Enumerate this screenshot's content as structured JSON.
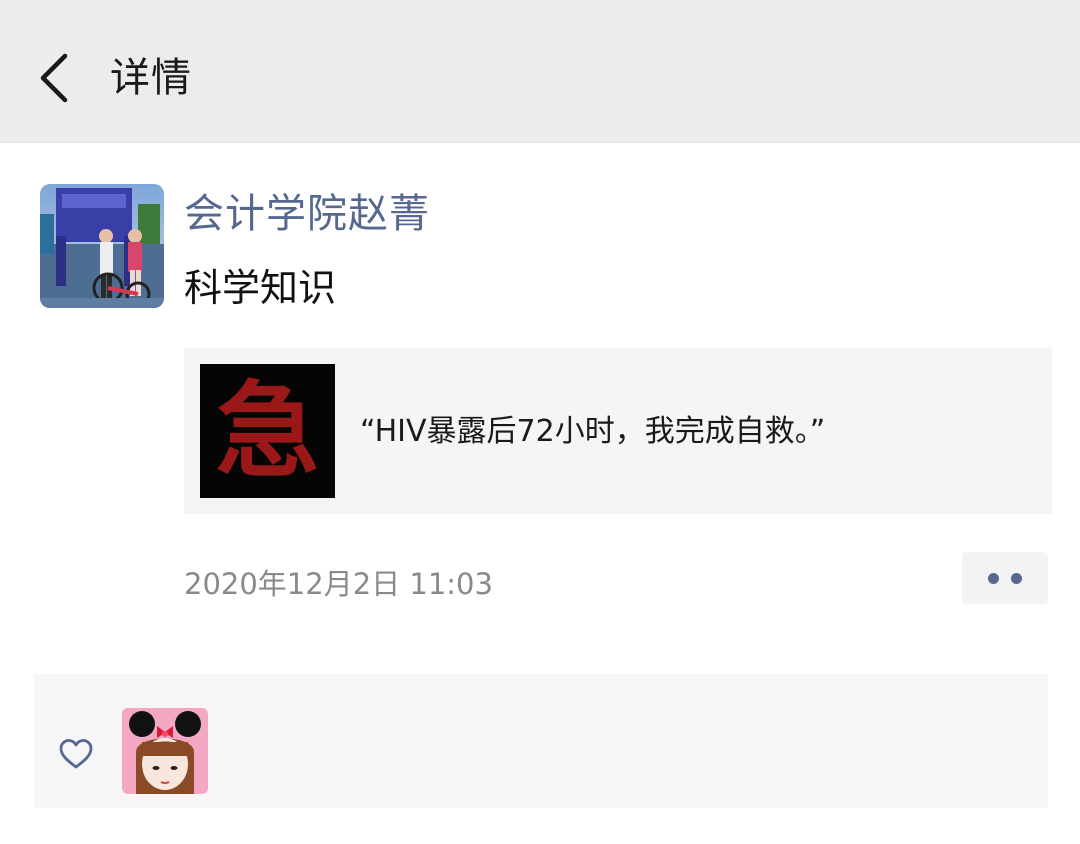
{
  "navbar": {
    "title": "详情",
    "back_icon": "chevron-left-icon"
  },
  "post": {
    "author": "会计学院赵菁",
    "text": "科学知识",
    "link_card": {
      "thumbnail_char": "急",
      "title": "“HIV暴露后72小时，我完成自救。”"
    },
    "timestamp": "2020年12月2日 11:03",
    "more_icon": "more-dots-icon"
  },
  "likes": {
    "icon": "heart-outline-icon"
  },
  "colors": {
    "accent": "#56688f",
    "navbar_bg": "#ececec",
    "card_bg": "#f5f5f7",
    "thumb_red": "#9b1818"
  }
}
